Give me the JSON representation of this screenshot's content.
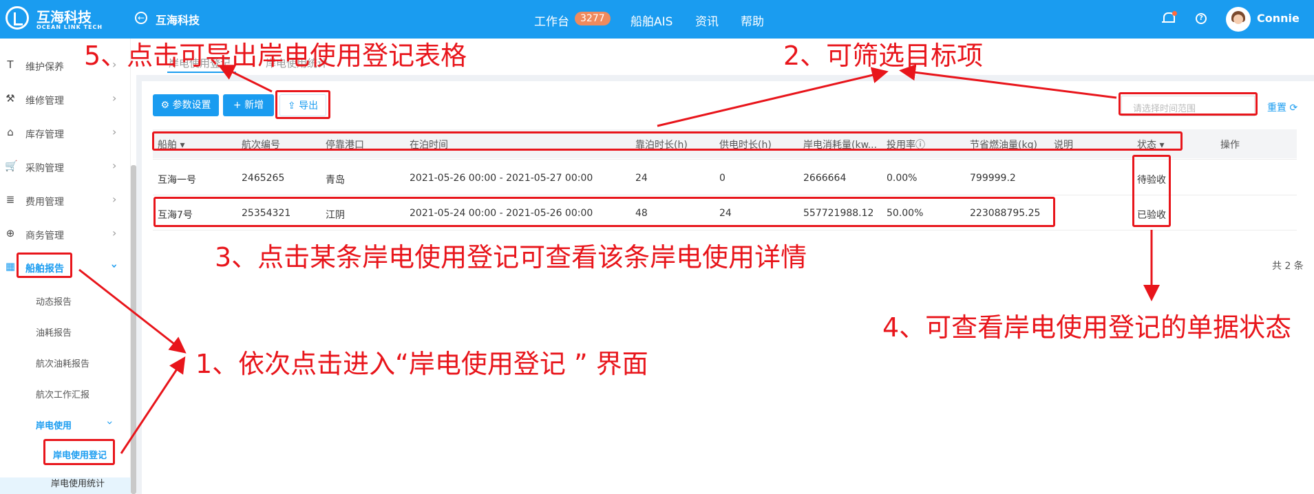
{
  "header": {
    "brand_cn": "互海科技",
    "brand_en": "OCEAN LINK TECH",
    "page_brand": "互海科技",
    "nav": [
      "工作台",
      "船舶AIS",
      "资讯",
      "帮助"
    ],
    "workbench_badge": "3277",
    "user_name": "Connie",
    "back_icon": "←",
    "help_icon": "?"
  },
  "sidebar": {
    "items": [
      {
        "label": "维护保养",
        "icon": "T"
      },
      {
        "label": "维修管理",
        "icon": "⚒"
      },
      {
        "label": "库存管理",
        "icon": "⌂"
      },
      {
        "label": "采购管理",
        "icon": "🛒"
      },
      {
        "label": "费用管理",
        "icon": "≣"
      },
      {
        "label": "商务管理",
        "icon": "⊕"
      },
      {
        "label": "船舶报告",
        "icon": "▦"
      }
    ],
    "sub_items": [
      "动态报告",
      "油耗报告",
      "航次油耗报告",
      "航次工作汇报"
    ],
    "group": "岸电使用",
    "group_items": [
      "岸电使用登记",
      "岸电使用统计"
    ]
  },
  "tabs": [
    "岸电使用登记",
    "岸电使用统计"
  ],
  "toolbar": {
    "params": "参数设置",
    "add": "新增",
    "export": "导出",
    "date_placeholder": "请选择时间范围",
    "reset": "重置"
  },
  "table": {
    "headers": [
      "船舶",
      "航次编号",
      "停靠港口",
      "在泊时间",
      "靠泊时长(h)",
      "供电时长(h)",
      "岸电消耗量(kw...",
      "投用率ⓘ",
      "节省燃油量(kg)",
      "说明",
      "状态",
      "操作"
    ],
    "rows": [
      [
        "互海一号",
        "2465265",
        "青岛",
        "2021-05-26 00:00 - 2021-05-27 00:00",
        "24",
        "0",
        "2666664",
        "0.00%",
        "799999.2",
        "",
        "待验收"
      ],
      [
        "互海7号",
        "25354321",
        "江阴",
        "2021-05-24 00:00 - 2021-05-26 00:00",
        "48",
        "24",
        "557721988.12",
        "50.00%",
        "223088795.25",
        "",
        "已验收"
      ]
    ],
    "total": "共 2 条"
  },
  "annotations": {
    "a1": "1、依次点击进入“岸电使用登记 ” 界面",
    "a2": "2、可筛选目标项",
    "a3": "3、点击某条岸电使用登记可查看该条岸电使用详情",
    "a4": "4、可查看岸电使用登记的单据状态",
    "a5": "5、点击可导出岸电使用登记表格"
  },
  "colors": {
    "primary": "#1a9cf0",
    "annotation": "#e8151b",
    "badge": "#f08a5d"
  }
}
